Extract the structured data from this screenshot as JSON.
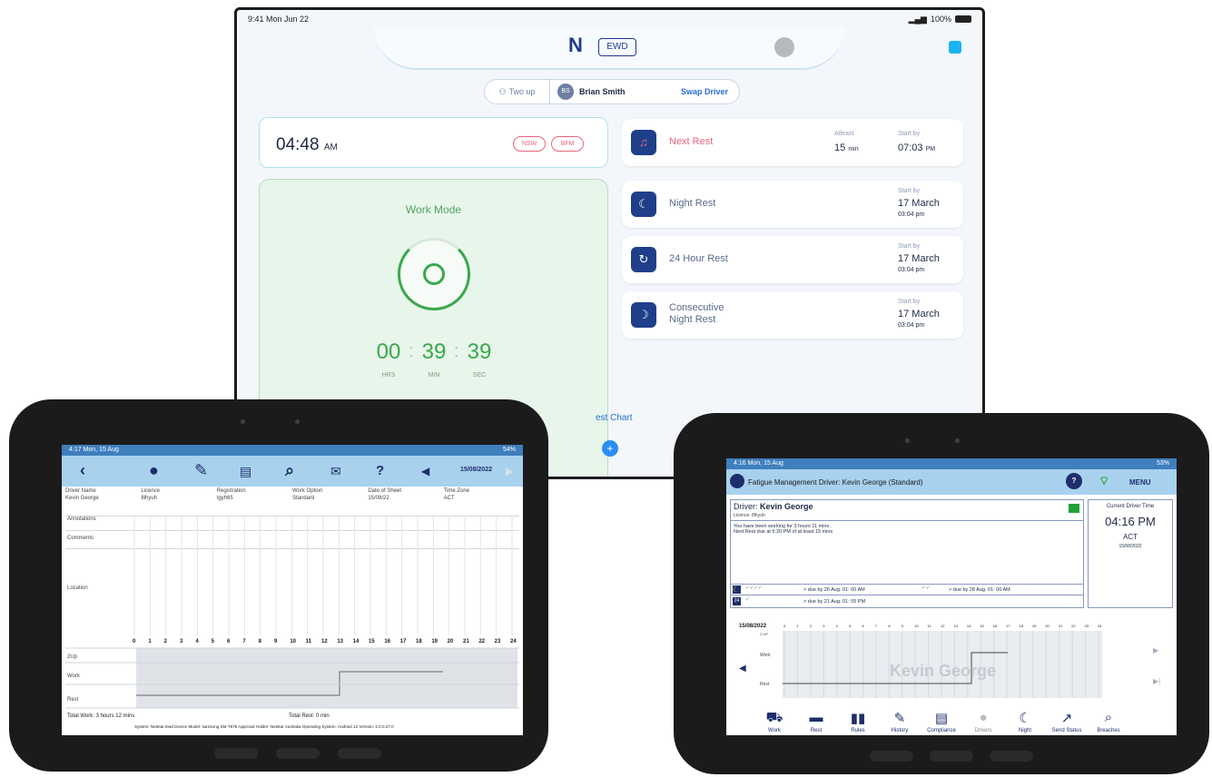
{
  "ewd": {
    "status_time": "9:41  Mon Jun 22",
    "status_battery": "100%",
    "logo": "N",
    "app_badge": "EWD",
    "two_up": "Two up",
    "driver_initials": "BS",
    "driver_name": "Brian Smith",
    "swap_driver": "Swap Driver",
    "current_time": "04:48",
    "current_ampm": "AM",
    "region_pills": [
      "NSW",
      "BFM"
    ],
    "work_mode_title": "Work Mode",
    "timer": {
      "hrs": "00",
      "min": "39",
      "sec": "39",
      "hrs_label": "HRS",
      "min_label": "MIN",
      "sec_label": "SEC"
    },
    "rests": [
      {
        "label": "Next Rest",
        "atleast_caption": "Atleast",
        "atleast_value": "15",
        "atleast_unit": "min",
        "start_caption": "Start by",
        "start_value": "07:03",
        "start_unit": "PM"
      },
      {
        "label": "Night Rest",
        "start_caption": "Start by",
        "start_value": "17 March",
        "start_time": "03:04 pm"
      },
      {
        "label": "24 Hour Rest",
        "start_caption": "Start by",
        "start_value": "17 March",
        "start_time": "03:04 pm"
      },
      {
        "label_line1": "Consecutive",
        "label_line2": "Night Rest",
        "start_caption": "Start by",
        "start_value": "17 March",
        "start_time": "03:04 pm"
      }
    ],
    "rest_chart_tab": "est Chart",
    "colors": {
      "accent": "#1f3f8a",
      "green": "#3ba84b",
      "alert": "#e8657a"
    }
  },
  "left_tablet": {
    "status_time": "4:17  Mon, 15 Aug",
    "status_right": "54%",
    "date": "15/08/2022",
    "headers": [
      "Driver Name",
      "Licence",
      "Registration",
      "Work Option",
      "Date of Sheet",
      "Time Zone"
    ],
    "values": [
      "Kevin George",
      "8lhyuh",
      "tgyh65",
      "Standard",
      "15/08/22",
      "ACT"
    ],
    "rows": [
      "Annotations",
      "Comments",
      "Location"
    ],
    "hours": [
      "0",
      "1",
      "2",
      "3",
      "4",
      "5",
      "6",
      "7",
      "8",
      "9",
      "10",
      "11",
      "12",
      "13",
      "14",
      "15",
      "16",
      "17",
      "18",
      "19",
      "20",
      "21",
      "22",
      "23",
      "24"
    ],
    "chart_rows": [
      "2Up",
      "Work",
      "Rest"
    ],
    "total_work": "Total Work: 3 hours 12 mins",
    "total_rest": "Total Rest: 0 min",
    "footer": "System: Netstar Ewd  Device Model: samsung SM-T575  Approval Holder: Netstar Australia  Operating System: Android 12  Version: 1.0.0.27.0"
  },
  "right_tablet": {
    "status_time": "4:16  Mon, 15 Aug",
    "status_right": "53%",
    "header_title": "Fatigue Management Driver: Kevin George (Standard)",
    "menu": "MENU",
    "driver_label": "Driver:",
    "driver_name": "Kevin George",
    "licence_label": "Licence:",
    "licence_value": "8lhyuh",
    "message_line1": "You have been working for 3 hours 11 mins .",
    "message_line2": "Next Rest due at 6:20 PM of at least 15 mins",
    "current_driver_time_label": "Current Driver Time",
    "current_time": "04:16 PM",
    "timezone": "ACT",
    "date": "15/08/2022",
    "due1": "> due by 26 Aug. 01: 00 AM",
    "due2": "> due by 28 Aug. 01: 00 AM",
    "due3": "> due by 21 Aug. 01: 05 PM",
    "badge_24": "24",
    "chart_date": "15/08/2022",
    "chart_rows": [
      "2 UP",
      "Work",
      "Rest"
    ],
    "watermark": "Kevin George",
    "buttons": [
      "Work",
      "Rest",
      "Rules",
      "History",
      "Compliance",
      "Drivers",
      "Night",
      "Send Status",
      "Breaches"
    ]
  }
}
